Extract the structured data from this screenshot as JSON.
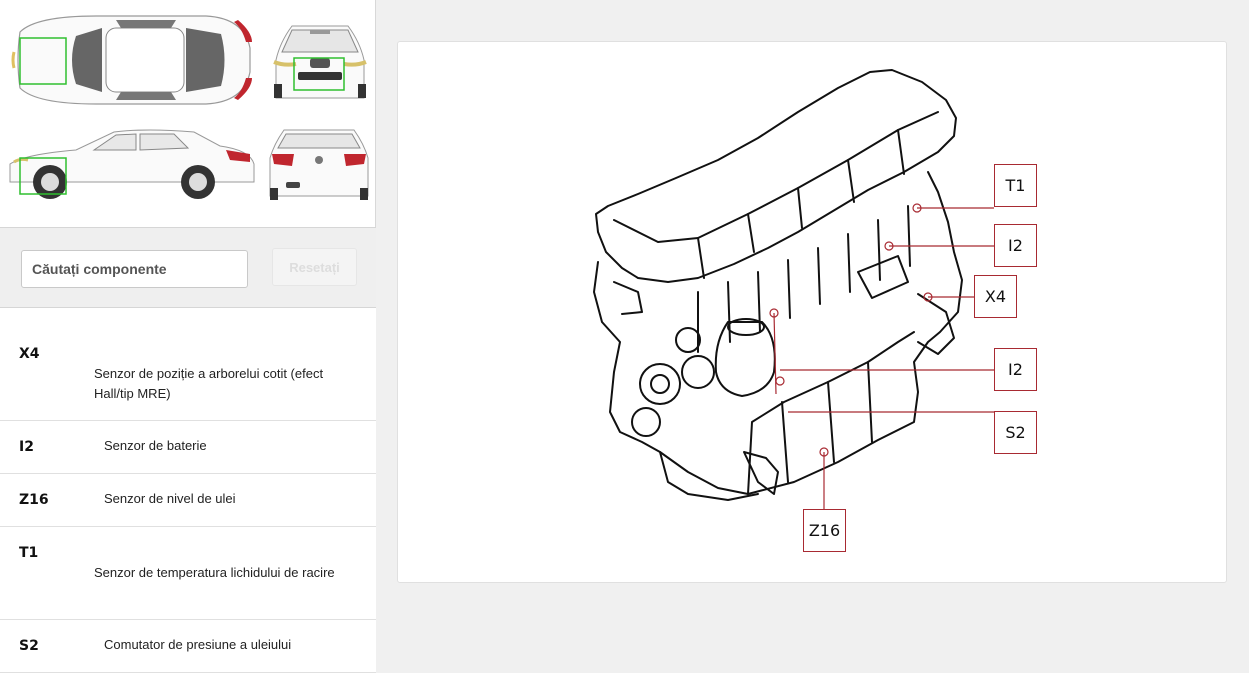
{
  "thumbnails": [
    {
      "name": "top view",
      "selected": true
    },
    {
      "name": "front view",
      "selected": true
    },
    {
      "name": "side view",
      "selected": true
    },
    {
      "name": "rear view",
      "selected": false
    }
  ],
  "search": {
    "placeholder": "Căutați componente",
    "reset_label": "Resetați"
  },
  "components": [
    {
      "code": "X4",
      "description": "Senzor de poziție a arborelui cotit (efect Hall/tip MRE)"
    },
    {
      "code": "I2",
      "description": "Senzor de baterie"
    },
    {
      "code": "Z16",
      "description": "Senzor de nivel de ulei"
    },
    {
      "code": "T1",
      "description": "Senzor de temperatura lichidului de racire"
    },
    {
      "code": "S2",
      "description": "Comutator de presiune a uleiului"
    }
  ],
  "callouts": [
    {
      "label": "T1"
    },
    {
      "label": "I2"
    },
    {
      "label": "X4"
    },
    {
      "label": "I2"
    },
    {
      "label": "S2"
    },
    {
      "label": "Z16"
    }
  ],
  "colors": {
    "callout": "#a82a32",
    "highlight": "#2fbf2f"
  }
}
